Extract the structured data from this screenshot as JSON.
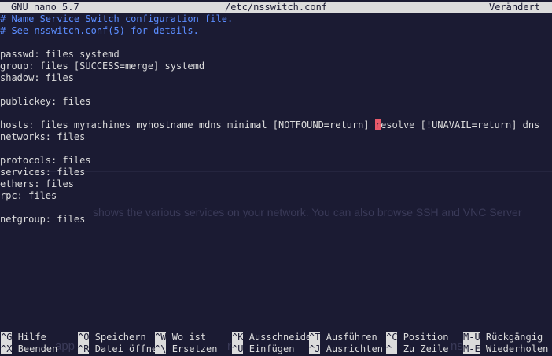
{
  "titlebar": {
    "app": "GNU nano 5.7",
    "file": "/etc/nsswitch.conf",
    "status": "Verändert"
  },
  "buffer": {
    "comment1": "# Name Service Switch configuration file.",
    "comment2": "# See nsswitch.conf(5) for details.",
    "passwd": "passwd: files systemd",
    "group": "group: files [SUCCESS=merge] systemd",
    "shadow": "shadow: files",
    "publickey": "publickey: files",
    "hosts_before_cursor": "hosts: files mymachines myhostname mdns_minimal [NOTFOUND=return] ",
    "hosts_cursor_char": "r",
    "hosts_after_cursor": "esolve [!UNAVAIL=return] dns",
    "networks": "networks: files",
    "protocols": "protocols: files",
    "services": "services: files",
    "ethers": "ethers: files",
    "rpc": "rpc: files",
    "netgroup": "netgroup: files"
  },
  "background_ghost": {
    "line1": "shows the various services on your network. You can also browse SSH and VNC Server",
    "line2": "app",
    "line3": "ra",
    "line4": "ns"
  },
  "shortcuts": [
    {
      "key": "^G",
      "label": "Hilfe"
    },
    {
      "key": "^O",
      "label": "Speichern"
    },
    {
      "key": "^W",
      "label": "Wo ist"
    },
    {
      "key": "^K",
      "label": "Ausschneide"
    },
    {
      "key": "^T",
      "label": "Ausführen"
    },
    {
      "key": "^C",
      "label": "Position"
    },
    {
      "key": "M-U",
      "label": "Rückgängig"
    },
    {
      "key": "^X",
      "label": "Beenden"
    },
    {
      "key": "^R",
      "label": "Datei öffne"
    },
    {
      "key": "^\\",
      "label": "Ersetzen"
    },
    {
      "key": "^U",
      "label": "Einfügen"
    },
    {
      "key": "^J",
      "label": "Ausrichten"
    },
    {
      "key": "^_",
      "label": "Zu Zeile"
    },
    {
      "key": "M-E",
      "label": "Wiederholen"
    }
  ]
}
